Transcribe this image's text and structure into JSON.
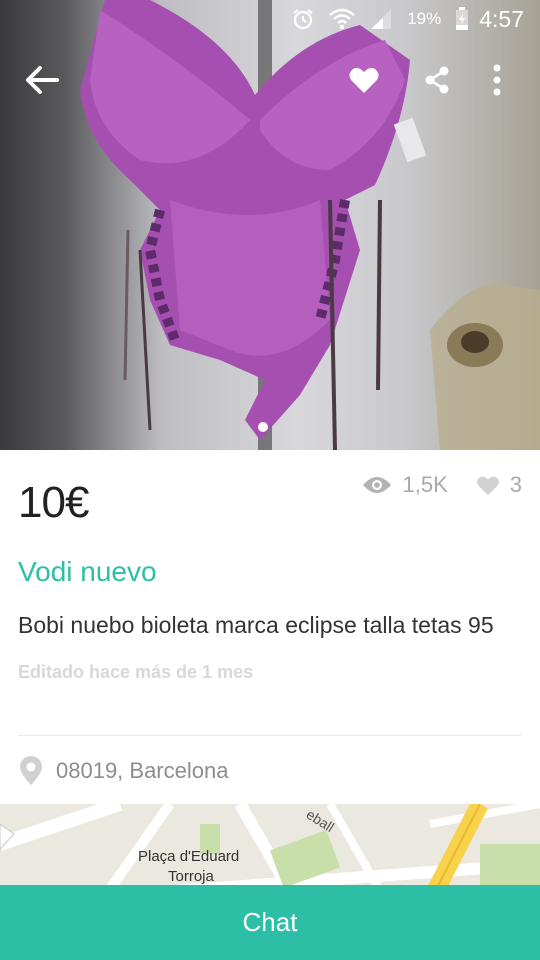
{
  "status_bar": {
    "battery_percent": "19%",
    "time": "4:57",
    "icons": [
      "alarm-icon",
      "wifi-icon",
      "signal-icon",
      "battery-icon"
    ]
  },
  "toolbar": {
    "icons": [
      "back-arrow-icon",
      "heart-icon",
      "share-icon",
      "more-vert-icon"
    ]
  },
  "gallery": {
    "current_index": 1,
    "total": 1
  },
  "listing": {
    "price": "10€",
    "views": "1,5K",
    "likes": "3",
    "title": "Vodi nuevo",
    "description": "Bobi nuebo bioleta marca eclipse talla tetas 95",
    "edited": "Editado hace más de 1 mes",
    "location": "08019, Barcelona"
  },
  "map": {
    "label_line1": "Plaça d'Eduard",
    "label_line2": "Torroja",
    "street_fragment": "eball"
  },
  "chat": {
    "label": "Chat"
  },
  "colors": {
    "accent": "#2dbfa6",
    "muted": "#a9a9a9"
  }
}
